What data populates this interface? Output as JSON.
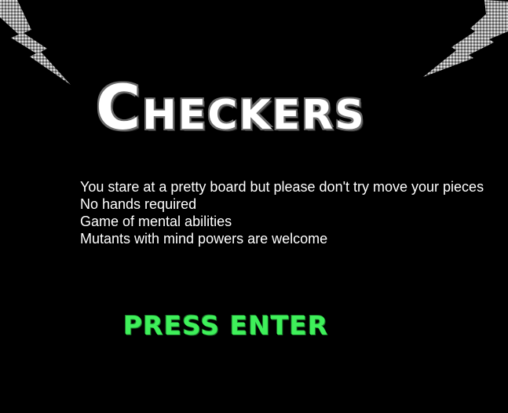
{
  "title": {
    "first_letter": "C",
    "rest": "HECKERS"
  },
  "intro_lines": [
    "You stare at a pretty board but please don't try move your pieces",
    "No hands required",
    "Game of mental abilities",
    "Mutants with mind powers are welcome"
  ],
  "prompt": {
    "label": "PRESS ENTER"
  },
  "colors": {
    "background": "#000000",
    "title": "#ffffff",
    "prompt": "#3ff05a",
    "lightning": "#c8c8c8"
  },
  "icons": {
    "left": "lightning-bolt-icon",
    "right": "lightning-bolt-icon"
  }
}
